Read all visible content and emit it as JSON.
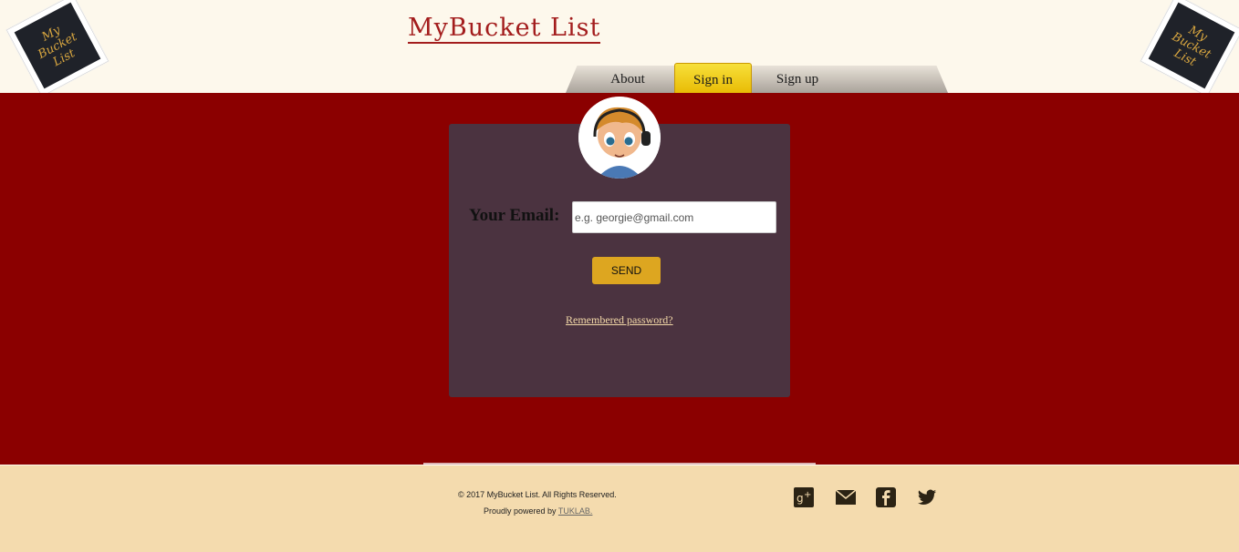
{
  "header": {
    "title": "MyBucket List",
    "logo_text": [
      "My",
      "Bucket",
      "List"
    ],
    "nav": {
      "about": "About",
      "sign_in": "Sign in",
      "sign_up": "Sign up"
    }
  },
  "form": {
    "email_label": "Your Email:",
    "email_placeholder": "e.g. georgie@gmail.com",
    "send_label": "SEND",
    "remembered_link": "Remembered password?"
  },
  "footer": {
    "copyright": "© 2017 MyBucket List. All Rights Reserved.",
    "powered_prefix": "Proudly powered by",
    "powered_link": "TUKLAB.",
    "social_icons": [
      "google-plus-icon",
      "mail-icon",
      "facebook-icon",
      "twitter-icon"
    ]
  },
  "colors": {
    "main_bg": "#8b0000",
    "panel_bg": "#4b3340",
    "accent": "#dda620",
    "footer_bg": "#f4dbae",
    "title": "#a31d1d"
  }
}
